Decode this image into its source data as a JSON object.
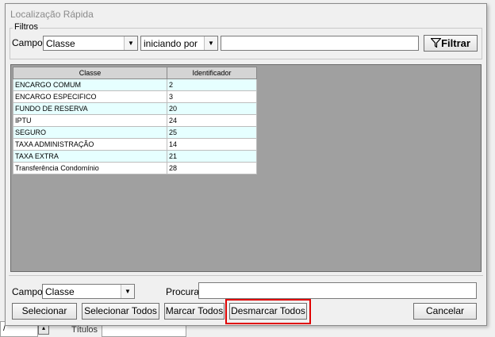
{
  "background": {
    "bottom_combo_value": "/",
    "bottom_label": "Títulos"
  },
  "dialog": {
    "title": "Localização Rápida",
    "filters": {
      "legend": "Filtros",
      "campo_label": "Campo:",
      "campo_value": "Classe",
      "operator_value": "iniciando por",
      "search_value": "",
      "filter_button": "Filtrar"
    },
    "grid": {
      "columns": [
        "Classe",
        "Identificador"
      ],
      "rows": [
        {
          "classe": "ENCARGO COMUM",
          "id": "2"
        },
        {
          "classe": "ENCARGO ESPECIFICO",
          "id": "3"
        },
        {
          "classe": "FUNDO DE RESERVA",
          "id": "20"
        },
        {
          "classe": "IPTU",
          "id": "24"
        },
        {
          "classe": "SEGURO",
          "id": "25"
        },
        {
          "classe": "TAXA ADMINISTRAÇÃO",
          "id": "14"
        },
        {
          "classe": "TAXA EXTRA",
          "id": "21"
        },
        {
          "classe": "Transferência Condomínio",
          "id": "28"
        }
      ]
    },
    "bottom": {
      "campo_label": "Campo:",
      "campo_value": "Classe",
      "procura_label": "Procura:",
      "procura_value": ""
    },
    "buttons": {
      "selecionar": "Selecionar",
      "selecionar_todos": "Selecionar Todos",
      "marcar_todos": "Marcar Todos",
      "desmarcar_todos": "Desmarcar Todos",
      "cancelar": "Cancelar"
    },
    "highlight_color": "#e00000"
  }
}
